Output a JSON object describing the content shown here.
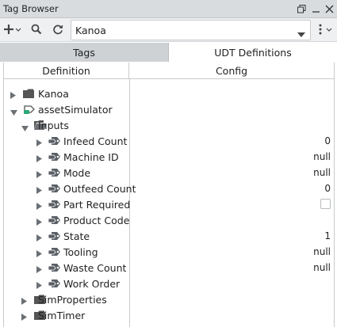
{
  "window": {
    "title": "Tag Browser"
  },
  "toolbar": {
    "provider_value": "Kanoa"
  },
  "tabs": [
    {
      "label": "Tags"
    },
    {
      "label": "UDT Definitions"
    }
  ],
  "grid": {
    "headers": {
      "definition": "Definition",
      "config": "Config"
    },
    "rows": [
      {
        "label": "Kanoa",
        "type": "folder",
        "expanded": false,
        "value": ""
      },
      {
        "label": "assetSimulator",
        "type": "udt",
        "expanded": true,
        "value": ""
      },
      {
        "label": "Inputs",
        "type": "folder-open",
        "expanded": true,
        "value": ""
      },
      {
        "label": "Infeed Count",
        "type": "tag",
        "expanded": false,
        "value": "0"
      },
      {
        "label": "Machine ID",
        "type": "tag",
        "expanded": false,
        "value": "null"
      },
      {
        "label": "Mode",
        "type": "tag",
        "expanded": false,
        "value": "null"
      },
      {
        "label": "Outfeed Count",
        "type": "tag",
        "expanded": false,
        "value": "0"
      },
      {
        "label": "Part Required",
        "type": "tag",
        "expanded": false,
        "value": "",
        "checkbox": true
      },
      {
        "label": "Product Code",
        "type": "tag",
        "expanded": false,
        "value": ""
      },
      {
        "label": "State",
        "type": "tag",
        "expanded": false,
        "value": "1"
      },
      {
        "label": "Tooling",
        "type": "tag",
        "expanded": false,
        "value": "null"
      },
      {
        "label": "Waste Count",
        "type": "tag",
        "expanded": false,
        "value": "null"
      },
      {
        "label": "Work Order",
        "type": "tag",
        "expanded": false,
        "value": ""
      },
      {
        "label": "SimProperties",
        "type": "folder",
        "expanded": false,
        "value": ""
      },
      {
        "label": "SimTimer",
        "type": "folder",
        "expanded": false,
        "value": ""
      }
    ]
  },
  "icons": {
    "restore": "restore-window-icon",
    "minimize": "minimize-icon",
    "close": "close-icon",
    "add": "plus-icon",
    "search": "search-icon",
    "refresh": "refresh-icon",
    "more": "kebab-menu-icon"
  },
  "colors": {
    "folder": "#555555",
    "udt_accent": "#2aa876",
    "tag_icon": "#5a5f66"
  }
}
